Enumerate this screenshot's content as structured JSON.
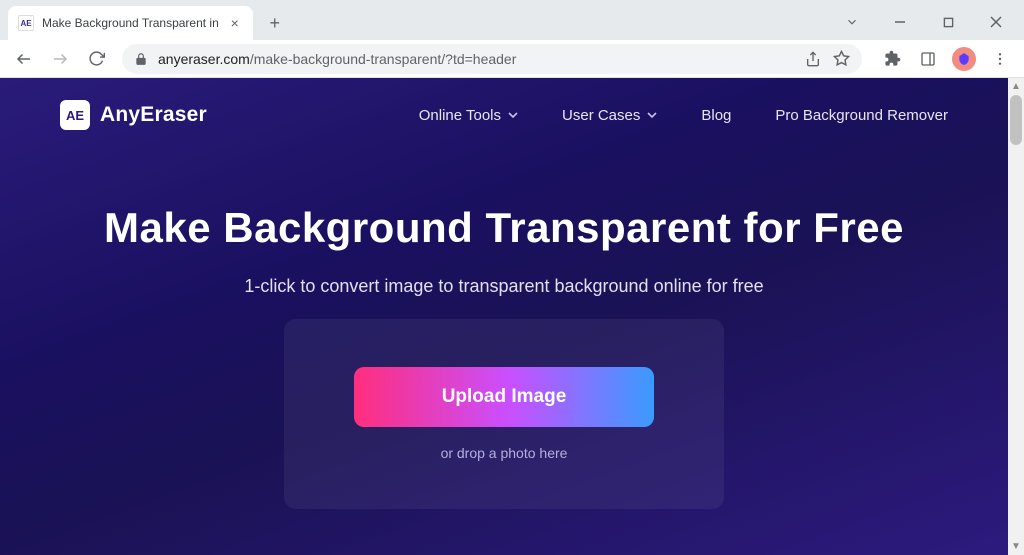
{
  "browser": {
    "tab": {
      "title": "Make Background Transparent in",
      "favicon_text": "AE"
    },
    "url": {
      "domain": "anyeraser.com",
      "path": "/make-background-transparent/?td=header"
    }
  },
  "site": {
    "logo_text": "AE",
    "brand": "AnyEraser",
    "nav": {
      "online_tools": "Online Tools",
      "user_cases": "User Cases",
      "blog": "Blog",
      "pro": "Pro Background Remover"
    }
  },
  "hero": {
    "title": "Make Background Transparent for Free",
    "subtitle": "1-click to convert image to transparent background online for free",
    "upload_label": "Upload Image",
    "drop_hint": "or drop a photo here"
  }
}
